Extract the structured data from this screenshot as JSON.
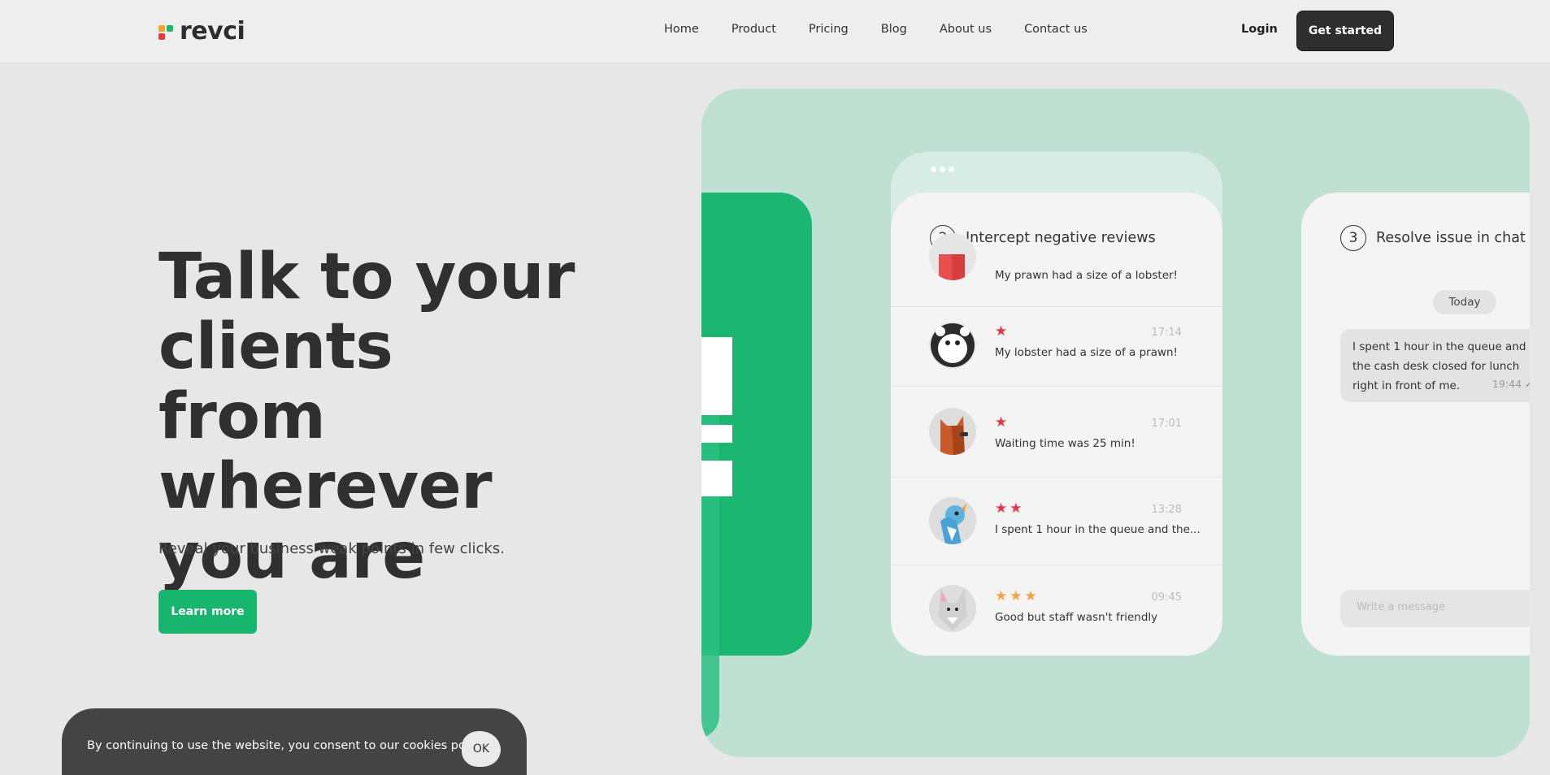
{
  "header": {
    "logo_text": "revci",
    "nav": [
      "Home",
      "Product",
      "Pricing",
      "Blog",
      "About us",
      "Contact us"
    ],
    "login": "Login",
    "get_started": "Get started"
  },
  "hero": {
    "title": "Talk to your clients from wherever you are",
    "subtitle": "Reveal your business weak points in few clicks.",
    "cta": "Learn more"
  },
  "cookie": {
    "text": "By continuing to use the website, you consent to our cookies policy.",
    "ok": "OK"
  },
  "reviews_card": {
    "step_number": "2",
    "step_title": "Intercept negative reviews",
    "items": [
      {
        "stars": 0,
        "time": "",
        "text": "My prawn had a size of a lobster!"
      },
      {
        "stars": 1,
        "time": "17:14",
        "text": "My lobster had a size of a prawn!"
      },
      {
        "stars": 1,
        "time": "17:01",
        "text": "Waiting time was 25 min!"
      },
      {
        "stars": 2,
        "time": "13:28",
        "text": "I spent 1 hour in the queue and the..."
      },
      {
        "stars": 3,
        "time": "09:45",
        "text": "Good but staff wasn't friendly"
      }
    ]
  },
  "chat_card": {
    "step_number": "3",
    "step_title": "Resolve issue in chat",
    "date_badge": "Today",
    "message": "I spent 1 hour in the queue and the cash desk closed for lunch right in front of me.",
    "message_time": "19:44",
    "input_placeholder": "Write a message"
  },
  "colors": {
    "brand_green": "#18b56f",
    "panel_mint": "#c0e0d4",
    "star_red": "#e8334a",
    "star_orange": "#f5a243",
    "dark_button": "#2e2e2e"
  }
}
